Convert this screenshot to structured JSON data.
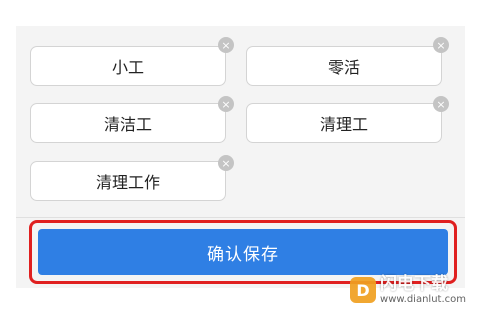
{
  "tags": [
    {
      "label": "小工",
      "close_icon": "×"
    },
    {
      "label": "零活",
      "close_icon": "×"
    },
    {
      "label": "清洁工",
      "close_icon": "×"
    },
    {
      "label": "清理工",
      "close_icon": "×"
    },
    {
      "label": "清理工作",
      "close_icon": "×"
    }
  ],
  "save_button": {
    "label": "确认保存"
  },
  "watermark": {
    "logo": "D",
    "name": "闪电下载",
    "url": "www.dianlut.com"
  },
  "colors": {
    "accent": "#2f7fe4",
    "highlight": "#e02020",
    "close_icon": "#c4c4c4"
  }
}
